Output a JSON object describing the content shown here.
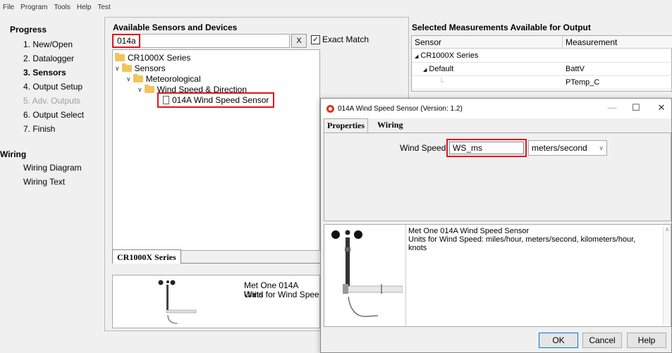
{
  "menu": [
    "File",
    "Program",
    "Tools",
    "Help",
    "Test"
  ],
  "progress": {
    "title": "Progress",
    "steps": [
      {
        "label": "1. New/Open",
        "state": "normal"
      },
      {
        "label": "2. Datalogger",
        "state": "normal"
      },
      {
        "label": "3. Sensors",
        "state": "active"
      },
      {
        "label": "4. Output Setup",
        "state": "normal"
      },
      {
        "label": "5. Adv. Outputs",
        "state": "disabled"
      },
      {
        "label": "6. Output Select",
        "state": "normal"
      },
      {
        "label": "7. Finish",
        "state": "normal"
      }
    ]
  },
  "wiring": {
    "title": "Wiring",
    "items": [
      "Wiring Diagram",
      "Wiring Text"
    ]
  },
  "available": {
    "title": "Available Sensors and Devices",
    "search_value": "014a",
    "clear_label": "X",
    "exact_match_label": "Exact Match",
    "exact_match_checked": "✓",
    "tree": [
      "CR1000X Series",
      "Sensors",
      "Meteorological",
      "Wind Speed & Direction",
      "014A Wind Speed Sensor"
    ],
    "tab_label": "CR1000X Series",
    "preview_line1": "Met One 014A Wind",
    "preview_line2": "Units for Wind Spee"
  },
  "selected": {
    "title": "Selected Measurements Available for Output",
    "col_sensor": "Sensor",
    "col_measurement": "Measurement",
    "rows": [
      {
        "sensor": "CR1000X Series",
        "measurement": ""
      },
      {
        "sensor": "Default",
        "measurement": "BattV"
      },
      {
        "sensor": "",
        "measurement": "PTemp_C"
      }
    ]
  },
  "dialog": {
    "title": "014A Wind Speed Sensor (Version: 1.2)",
    "minimize": "—",
    "maximize": "☐",
    "close": "✕",
    "tab_properties": "Properties",
    "tab_wiring": "Wiring",
    "field_label": "Wind Speed",
    "field_value": "WS_ms",
    "unit_value": "meters/second",
    "desc_line1": "Met One 014A Wind Speed Sensor",
    "desc_line2": "Units for Wind Speed: miles/hour, meters/second, kilometers/hour,",
    "desc_line3": "knots",
    "ok_label": "OK",
    "cancel_label": "Cancel",
    "help_label": "Help"
  },
  "colors": {
    "highlight": "#e0141e",
    "folder": "#f2c45a"
  }
}
